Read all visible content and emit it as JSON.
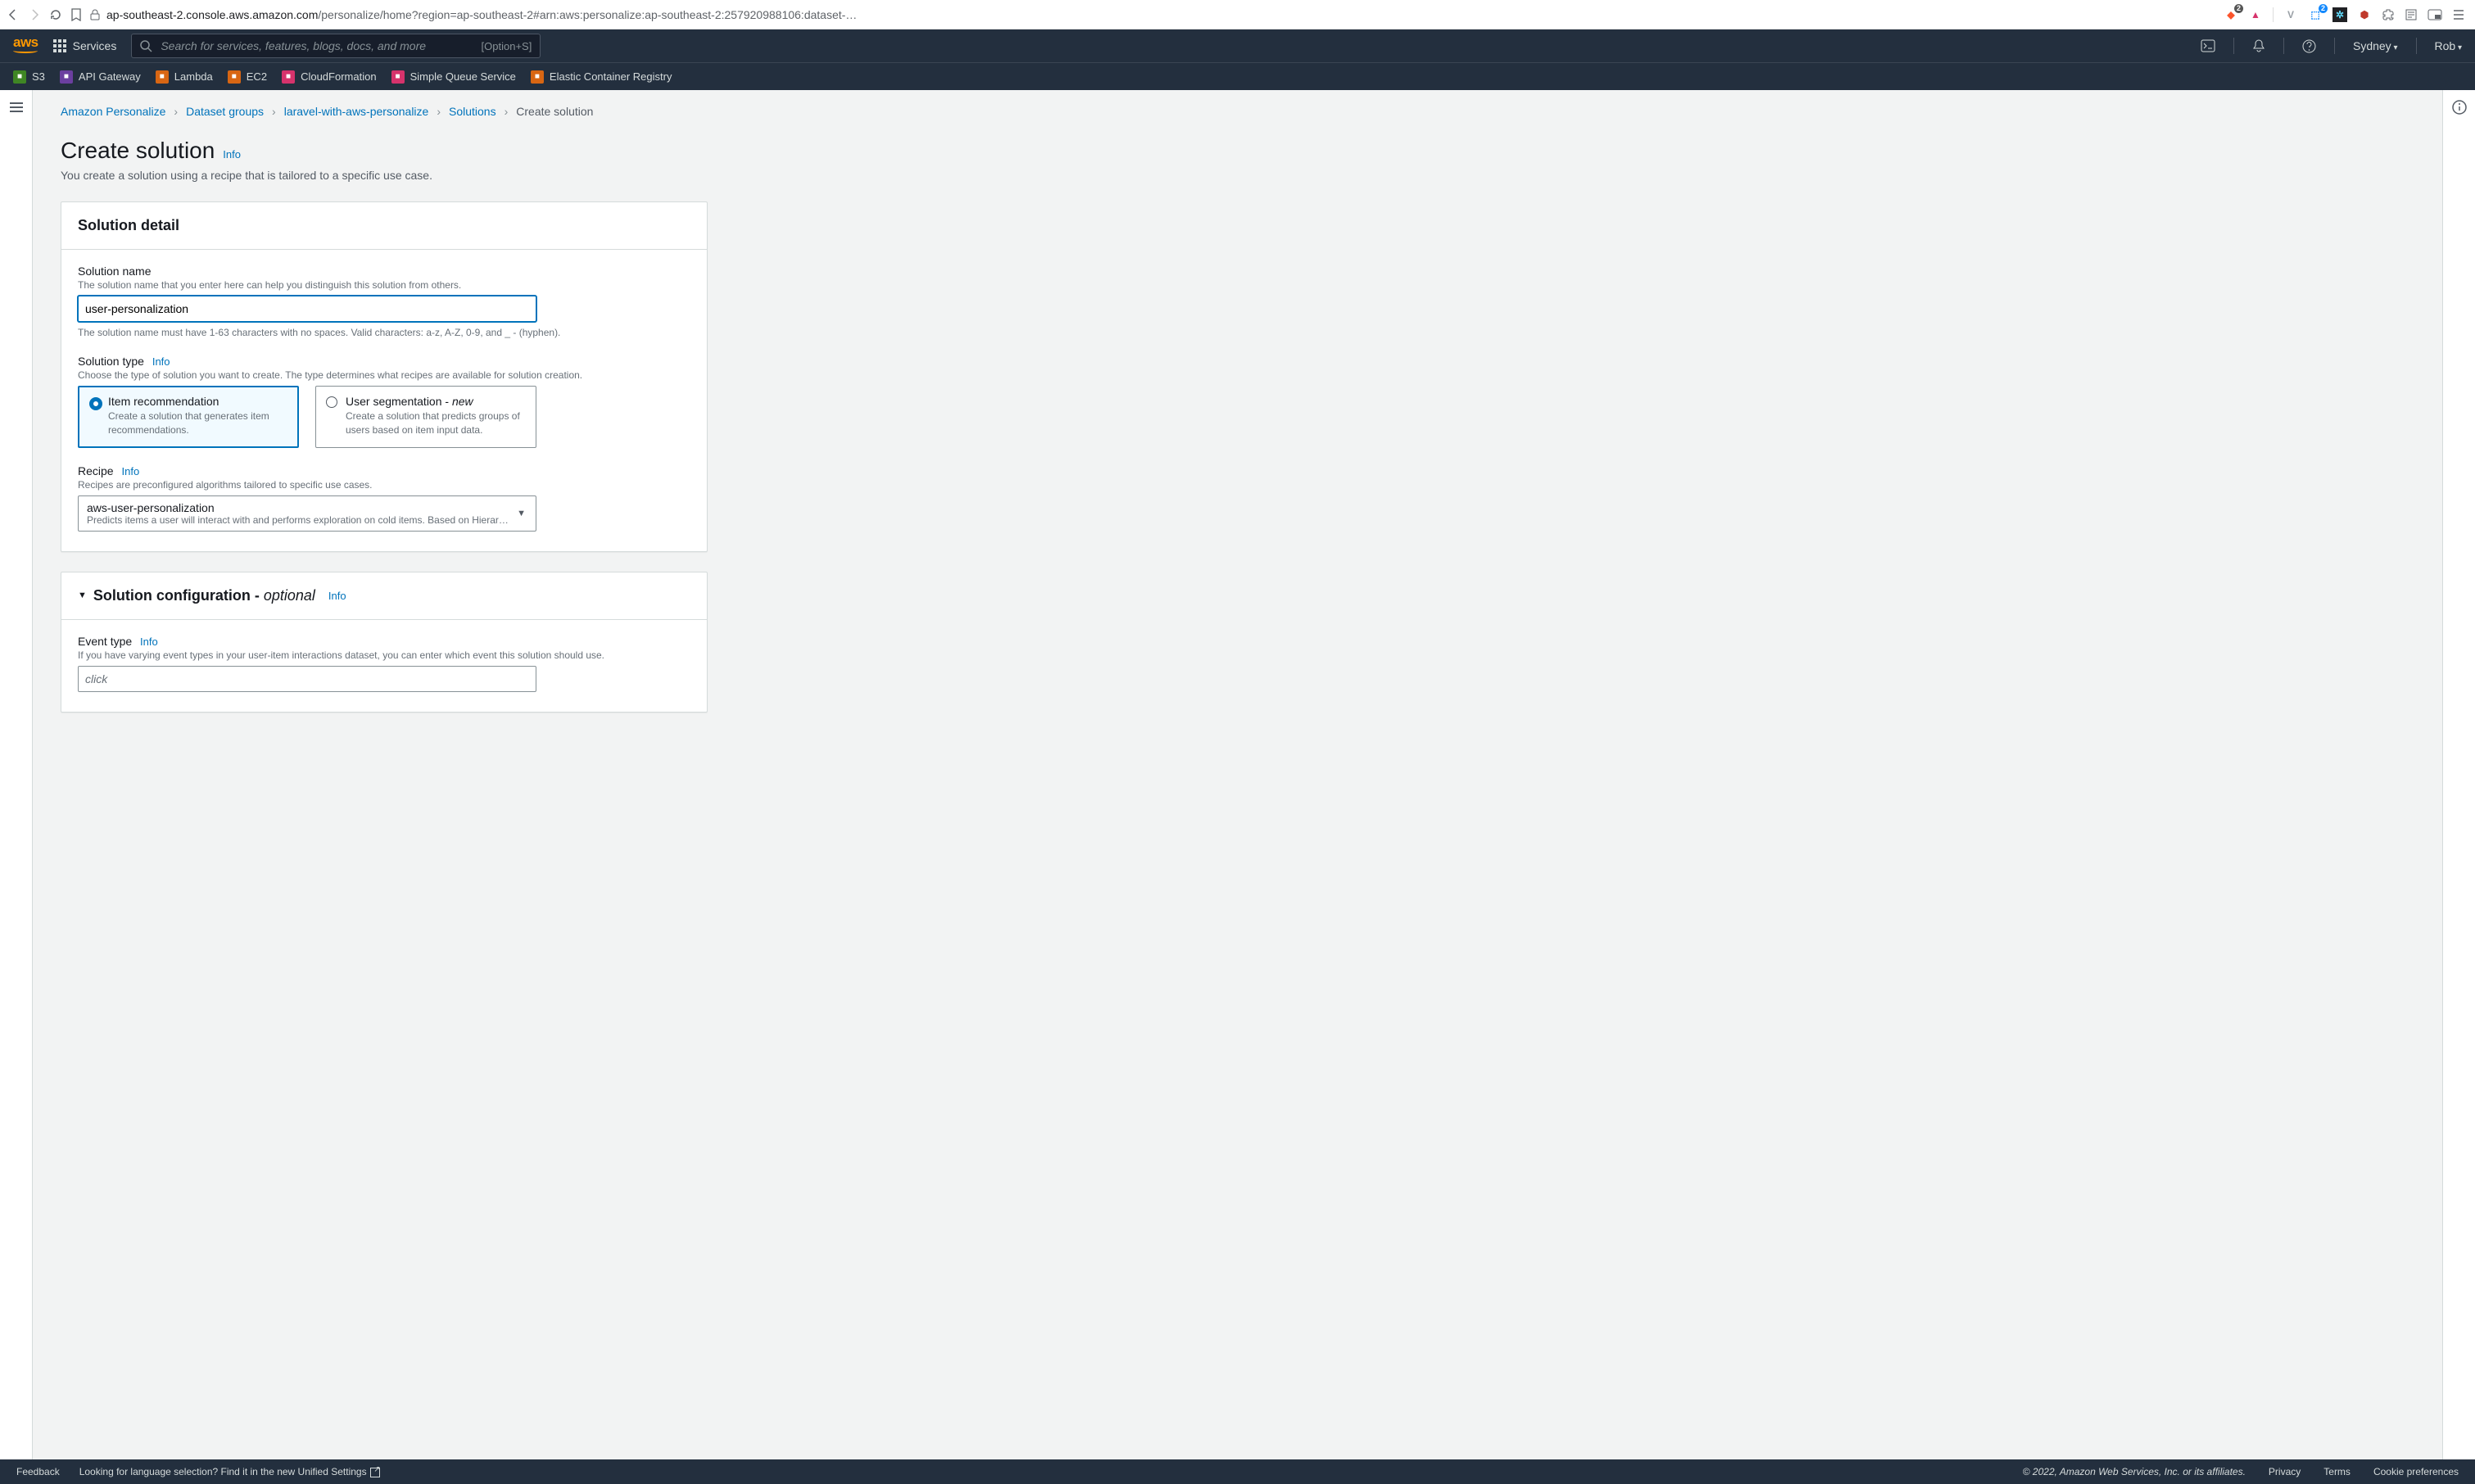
{
  "browser": {
    "url_host": "ap-southeast-2.console.aws.amazon.com",
    "url_path": "/personalize/home?region=ap-southeast-2#arn:aws:personalize:ap-southeast-2:257920988106:dataset-…",
    "ext_badge_brave": "2",
    "ext_badge_react": "2"
  },
  "nav": {
    "services": "Services",
    "search_placeholder": "Search for services, features, blogs, docs, and more",
    "search_hint": "[Option+S]",
    "region": "Sydney",
    "account": "Rob"
  },
  "favorites": [
    {
      "label": "S3",
      "color": "#3f8624"
    },
    {
      "label": "API Gateway",
      "color": "#6b3fa0"
    },
    {
      "label": "Lambda",
      "color": "#d86613"
    },
    {
      "label": "EC2",
      "color": "#d86613"
    },
    {
      "label": "CloudFormation",
      "color": "#d6336c"
    },
    {
      "label": "Simple Queue Service",
      "color": "#d6336c"
    },
    {
      "label": "Elastic Container Registry",
      "color": "#d86613"
    }
  ],
  "breadcrumbs": {
    "items": [
      "Amazon Personalize",
      "Dataset groups",
      "laravel-with-aws-personalize",
      "Solutions"
    ],
    "current": "Create solution"
  },
  "page": {
    "title": "Create solution",
    "info": "Info",
    "desc": "You create a solution using a recipe that is tailored to a specific use case."
  },
  "panel1": {
    "title": "Solution detail",
    "name_label": "Solution name",
    "name_hint": "The solution name that you enter here can help you distinguish this solution from others.",
    "name_value": "user-personalization",
    "name_help": "The solution name must have 1-63 characters with no spaces. Valid characters: a-z, A-Z, 0-9, and _ - (hyphen).",
    "type_label": "Solution type",
    "type_hint": "Choose the type of solution you want to create. The type determines what recipes are available for solution creation.",
    "tile1_title": "Item recommendation",
    "tile1_desc": "Create a solution that generates item recommendations.",
    "tile2_title": "User segmentation - ",
    "tile2_new": "new",
    "tile2_desc": "Create a solution that predicts groups of users based on item input data.",
    "recipe_label": "Recipe",
    "recipe_hint": "Recipes are preconfigured algorithms tailored to specific use cases.",
    "recipe_value": "aws-user-personalization",
    "recipe_desc": "Predicts items a user will interact with and performs exploration on cold items. Based on Hierarchical…"
  },
  "panel2": {
    "title_a": "Solution configuration - ",
    "title_b": "optional",
    "event_label": "Event type",
    "event_hint": "If you have varying event types in your user-item interactions dataset, you can enter which event this solution should use.",
    "event_placeholder": "click"
  },
  "footer": {
    "feedback": "Feedback",
    "lang_a": "Looking for language selection? Find it in the new ",
    "lang_b": "Unified Settings",
    "copy": "© 2022, Amazon Web Services, Inc. or its affiliates.",
    "privacy": "Privacy",
    "terms": "Terms",
    "cookies": "Cookie preferences"
  }
}
